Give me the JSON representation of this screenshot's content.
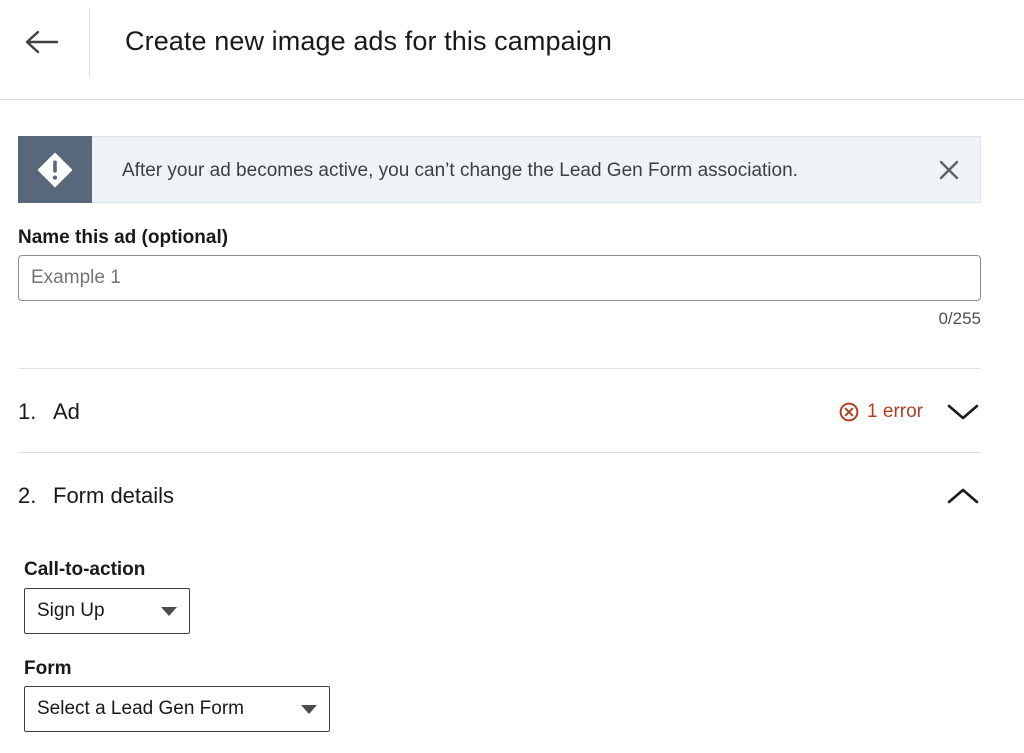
{
  "header": {
    "back_icon": "arrow-left-icon",
    "title": "Create new image ads for this campaign"
  },
  "alert": {
    "icon": "warning-diamond-icon",
    "text": "After your ad becomes active, you can’t change the Lead Gen Form association.",
    "close_icon": "close-icon"
  },
  "name_field": {
    "label": "Name this ad (optional)",
    "value": "",
    "placeholder": "Example 1",
    "counter": "0/255"
  },
  "sections": [
    {
      "number": "1.",
      "title": "Ad",
      "error_text": "1 error",
      "error_icon": "error-circle-icon",
      "state": "collapsed",
      "chevron_icon": "chevron-down-icon"
    },
    {
      "number": "2.",
      "title": "Form details",
      "state": "expanded",
      "chevron_icon": "chevron-up-icon"
    }
  ],
  "form_details": {
    "cta_label": "Call-to-action",
    "cta_value": "Sign Up",
    "form_label": "Form",
    "form_value": "Select a Lead Gen Form"
  },
  "colors": {
    "alert_icon_bg": "#56687a",
    "alert_bg": "#eef3f8",
    "error": "#b24020"
  }
}
